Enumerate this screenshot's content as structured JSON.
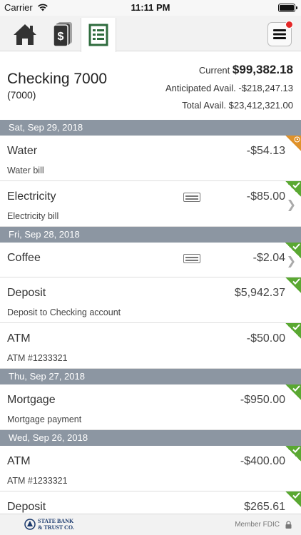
{
  "status_bar": {
    "carrier": "Carrier",
    "time": "11:11 PM"
  },
  "account": {
    "name": "Checking 7000",
    "number": "(7000)",
    "current_label": "Current",
    "current_value": "$99,382.18",
    "anticipated_label": "Anticipated Avail.",
    "anticipated_value": "-$218,247.13",
    "total_label": "Total Avail.",
    "total_value": "$23,412,321.00"
  },
  "groups": [
    {
      "date": "Sat, Sep 29, 2018",
      "items": [
        {
          "title": "Water",
          "desc": "Water bill",
          "amount": "-$54.13"
        },
        {
          "title": "Electricity",
          "desc": "Electricity bill",
          "amount": "-$85.00"
        }
      ]
    },
    {
      "date": "Fri, Sep 28, 2018",
      "items": [
        {
          "title": "Coffee",
          "desc": "",
          "amount": "-$2.04"
        },
        {
          "title": "Deposit",
          "desc": "Deposit to Checking account",
          "amount": "$5,942.37"
        },
        {
          "title": "ATM",
          "desc": "ATM #1233321",
          "amount": "-$50.00"
        }
      ]
    },
    {
      "date": "Thu, Sep 27, 2018",
      "items": [
        {
          "title": "Mortgage",
          "desc": "Mortgage payment",
          "amount": "-$950.00"
        }
      ]
    },
    {
      "date": "Wed, Sep 26, 2018",
      "items": [
        {
          "title": "ATM",
          "desc": "ATM #1233321",
          "amount": "-$400.00"
        },
        {
          "title": "Deposit",
          "desc": "",
          "amount": "$265.61"
        }
      ]
    }
  ],
  "footer": {
    "bank_name_line1": "STATE BANK",
    "bank_name_line2": "& TRUST CO.",
    "fdic": "Member FDIC"
  },
  "colors": {
    "date_header": "#8c96a2",
    "cleared": "#5aa832",
    "pending": "#e0922a",
    "notification": "#e42828"
  }
}
